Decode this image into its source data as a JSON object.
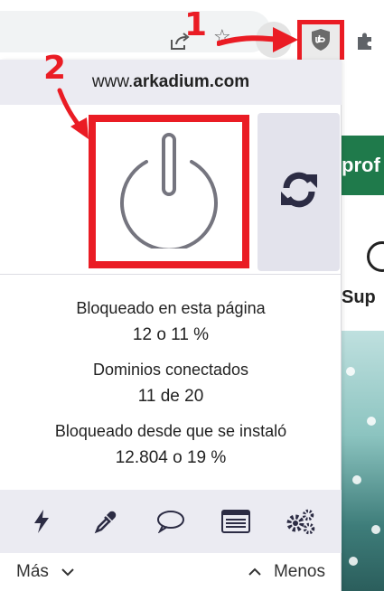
{
  "popup": {
    "hostname_prefix": "www.",
    "hostname_domain": "arkadium.com",
    "stats": {
      "blocked_page_label": "Bloqueado en esta página",
      "blocked_page_value": "12 o 11 %",
      "domains_label": "Dominios conectados",
      "domains_value": "11 de 20",
      "blocked_total_label": "Bloqueado desde que se instaló",
      "blocked_total_value": "12.804 o 19 %"
    },
    "tools": [
      {
        "icon": "lightning-icon"
      },
      {
        "icon": "eyedropper-icon"
      },
      {
        "icon": "speech-bubble-icon"
      },
      {
        "icon": "list-window-icon"
      },
      {
        "icon": "gears-icon"
      }
    ],
    "more_label": "Más",
    "less_label": "Menos"
  },
  "page_behind": {
    "green_text": "prof",
    "sup_text": "Sup"
  },
  "annotations": {
    "marker_1": "1",
    "marker_2": "2"
  },
  "colors": {
    "highlight_red": "#ea1c24",
    "popup_bar": "#ebebf2",
    "icon_dark": "#2c2c44",
    "power_gray": "#75757f"
  }
}
